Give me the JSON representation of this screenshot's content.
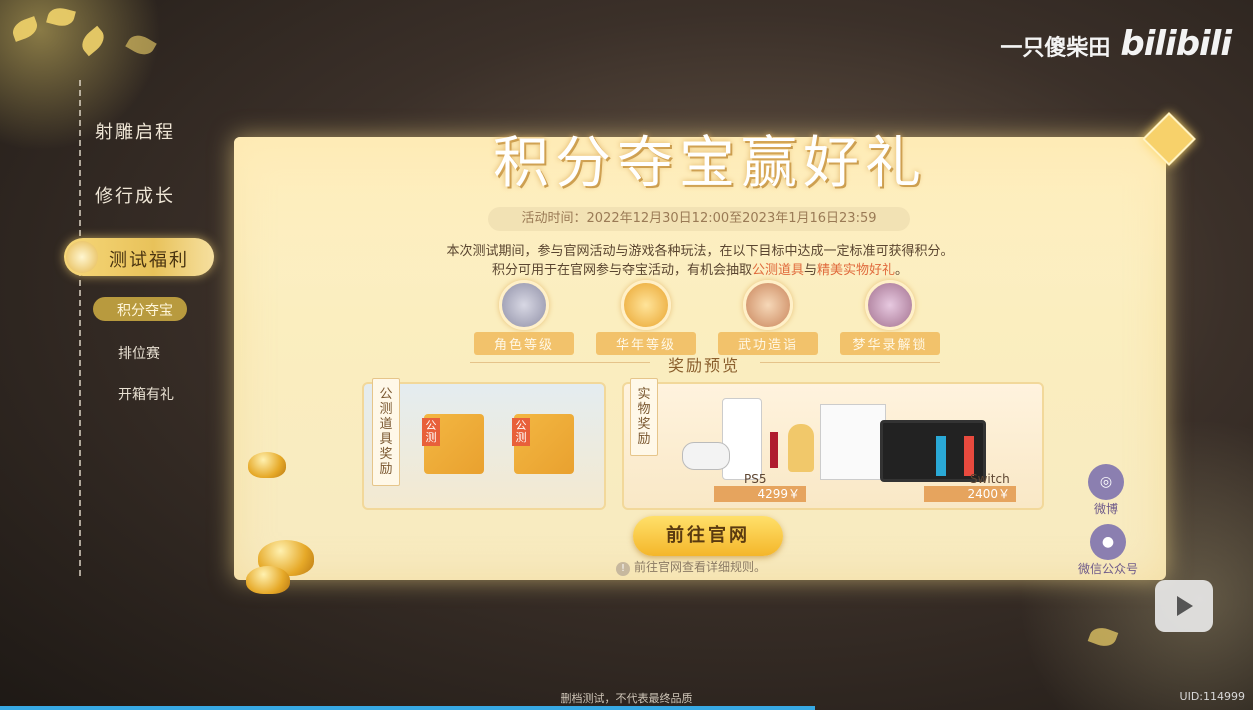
{
  "brand": {
    "channel": "一只傻柴田",
    "logo": "bilibili"
  },
  "sidebar": {
    "items": [
      {
        "label": "射雕启程"
      },
      {
        "label": "修行成长"
      },
      {
        "label": "测试福利"
      }
    ],
    "subitems": [
      {
        "label": "积分夺宝"
      },
      {
        "label": "排位赛"
      },
      {
        "label": "开箱有礼"
      }
    ]
  },
  "panel": {
    "title": "积分夺宝赢好礼",
    "time": "活动时间：2022年12月30日12:00至2023年1月16日23:59",
    "desc1": "本次测试期间，参与官网活动与游戏各种玩法，在以下目标中达成一定标准可获得积分。",
    "desc2_a": "积分可用于在官网参与夺宝活动，有机会抽取",
    "desc2_hl1": "公测道具",
    "desc2_b": "与",
    "desc2_hl2": "精美实物好礼",
    "desc2_c": "。",
    "goals": [
      {
        "label": "角色等级"
      },
      {
        "label": "华年等级"
      },
      {
        "label": "武功造诣"
      },
      {
        "label": "梦华录解锁"
      }
    ],
    "reward_preview": "奖励预览",
    "box1_tag": "公测道具奖励",
    "box2_tag": "实物奖励",
    "item_badge": "公测",
    "prizes": [
      {
        "name": "PS5",
        "price": "4299￥"
      },
      {
        "name": "Switch",
        "price": "2400￥"
      }
    ],
    "button": "前往官网",
    "rule_icon": "!",
    "rule": "前往官网查看详细规则。"
  },
  "social": {
    "weibo": "微博",
    "wechat": "微信公众号"
  },
  "footer": {
    "notice": "删档测试，不代表最终品质",
    "uid": "UID:114999"
  },
  "colors": {
    "accent": "#f4b62a",
    "highlight": "#e06a3c",
    "progress": "#37a9e4"
  }
}
